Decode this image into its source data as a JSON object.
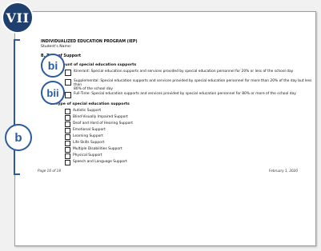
{
  "badges": {
    "step": "VII",
    "bi": "bi",
    "bii": "bii",
    "b": "b"
  },
  "header": {
    "title": "INDIVIDUALIZED EDUCATION PROGRAM (IEP)",
    "student_label": "Student's Name:"
  },
  "section": {
    "title": "B. Type of Support",
    "amount_heading": "1. Amount of special education supports",
    "amount_options": [
      {
        "label": "Itinerant: Special education supports and services provided by special education personnel for 20% or less of the school day"
      },
      {
        "label": "Supplemental: Special education supports and services provided by special education personnel for more than 20% of the day but less than",
        "label_line2": "80% of the school day"
      },
      {
        "label": "Full-Time: Special education supports and services provided by special education personnel for 80% or more of the school day"
      }
    ],
    "type_heading": "2. Type of special education supports",
    "type_options": [
      "Autistic Support",
      "Blind-Visually Impaired Support",
      "Deaf and Hard of Hearing Support",
      "Emotional Support",
      "Learning Support",
      "Life Skills Support",
      "Multiple Disabilities Support",
      "Physical Support",
      "Speech and Language Support"
    ]
  },
  "footer": {
    "page": "Page 16 of 18",
    "date": "February 1, 2020"
  },
  "colors": {
    "badge_fill": "#1f3f6e",
    "accent": "#2c5aa0"
  }
}
